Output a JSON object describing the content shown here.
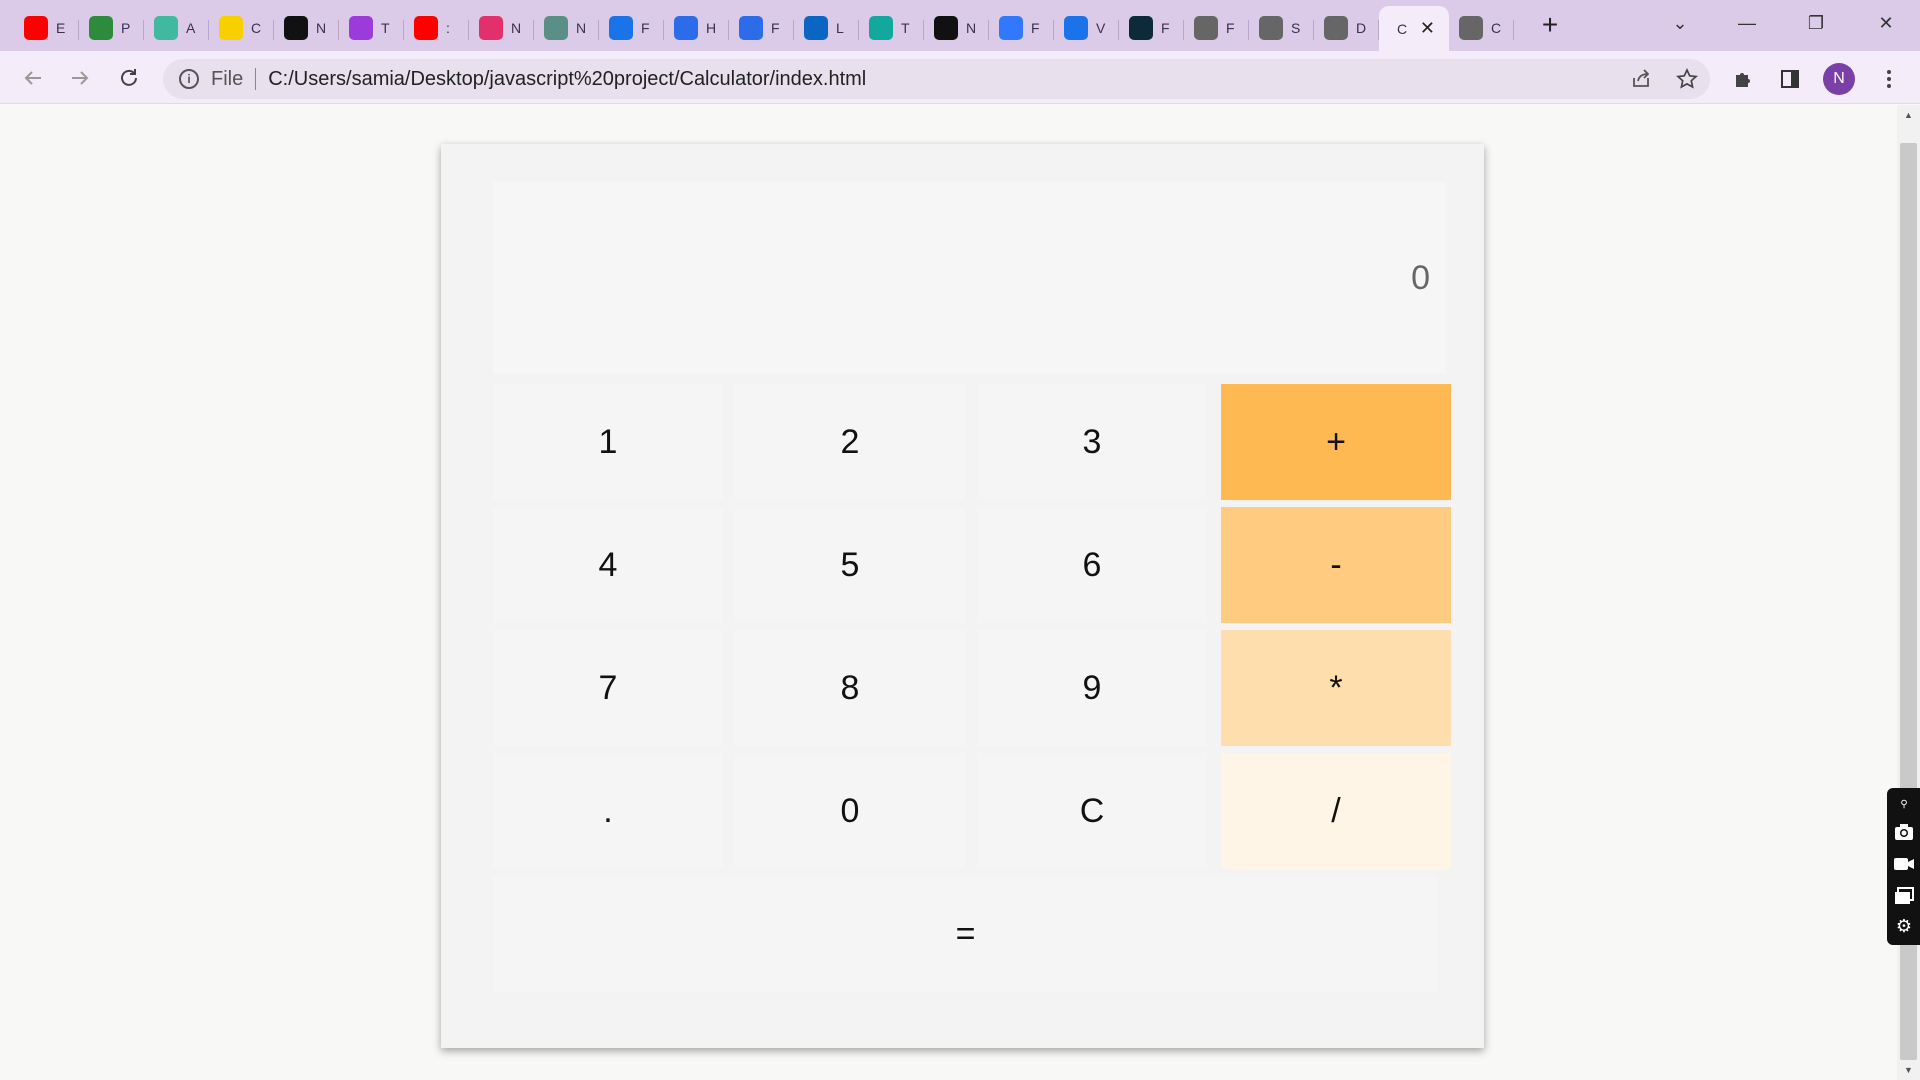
{
  "browser": {
    "tabs": [
      {
        "favicon": "youtube-icon",
        "letter": "E",
        "color": "#ff0000"
      },
      {
        "favicon": "px-icon",
        "letter": "P",
        "color": "#2e8b3e"
      },
      {
        "favicon": "d-icon",
        "letter": "A",
        "color": "#41b8a0"
      },
      {
        "favicon": "flipkart-icon",
        "letter": "C",
        "color": "#f8d000"
      },
      {
        "favicon": "m-icon",
        "letter": "N",
        "color": "#111111"
      },
      {
        "favicon": "u-icon",
        "letter": "T",
        "color": "#9b3bd9"
      },
      {
        "favicon": "youtube-icon",
        "letter": ":",
        "color": "#ff0000"
      },
      {
        "favicon": "instagram-icon",
        "letter": "N",
        "color": "#e1306c"
      },
      {
        "favicon": "openai-icon",
        "letter": "N",
        "color": "#5a8f86"
      },
      {
        "favicon": "n-icon",
        "letter": "F",
        "color": "#1a73e8"
      },
      {
        "favicon": "c-icon",
        "letter": "H",
        "color": "#2d6ce8"
      },
      {
        "favicon": "c-icon",
        "letter": "F",
        "color": "#2d6ce8"
      },
      {
        "favicon": "linkedin-icon",
        "letter": "L",
        "color": "#0a66c2"
      },
      {
        "favicon": "diamond-icon",
        "letter": "T",
        "color": "#13a89e"
      },
      {
        "favicon": "github-icon",
        "letter": "N",
        "color": "#111111"
      },
      {
        "favicon": "m2-icon",
        "letter": "F",
        "color": "#3178ff"
      },
      {
        "favicon": "ist-icon",
        "letter": "V",
        "color": "#1a73e8"
      },
      {
        "favicon": "react-icon",
        "letter": "F",
        "color": "#0c2a3a"
      },
      {
        "favicon": "globe-icon",
        "letter": "F",
        "color": "#666666"
      },
      {
        "favicon": "globe-icon",
        "letter": "S",
        "color": "#666666"
      },
      {
        "favicon": "globe-icon",
        "letter": "D",
        "color": "#666666"
      },
      {
        "favicon": "active",
        "letter": "C",
        "color": "#000000"
      },
      {
        "favicon": "globe-icon",
        "letter": "C",
        "color": "#666666"
      }
    ],
    "new_tab": "+",
    "tab_search": "⌄",
    "minimize": "—",
    "restore": "❐",
    "close": "✕",
    "scheme_label": "File",
    "url": "C:/Users/samia/Desktop/javascript%20project/Calculator/index.html",
    "profile_initial": "N"
  },
  "calculator": {
    "display_value": "0",
    "keys": [
      {
        "label": "1",
        "style": "num"
      },
      {
        "label": "2",
        "style": "num"
      },
      {
        "label": "3",
        "style": "num"
      },
      {
        "label": "+",
        "style": "op1"
      },
      {
        "label": "4",
        "style": "num"
      },
      {
        "label": "5",
        "style": "num"
      },
      {
        "label": "6",
        "style": "num"
      },
      {
        "label": "-",
        "style": "op2"
      },
      {
        "label": "7",
        "style": "num"
      },
      {
        "label": "8",
        "style": "num"
      },
      {
        "label": "9",
        "style": "num"
      },
      {
        "label": "*",
        "style": "op3"
      },
      {
        "label": ".",
        "style": "num"
      },
      {
        "label": "0",
        "style": "num"
      },
      {
        "label": "C",
        "style": "num"
      },
      {
        "label": "/",
        "style": "op4"
      }
    ],
    "equals_label": "=",
    "colors": {
      "plus": "#ffb952",
      "minus": "#ffcb80",
      "multiply": "#ffdeae",
      "divide": "#fff5e6",
      "key": "#f5f5f5",
      "panel": "#f3f3f3"
    }
  }
}
